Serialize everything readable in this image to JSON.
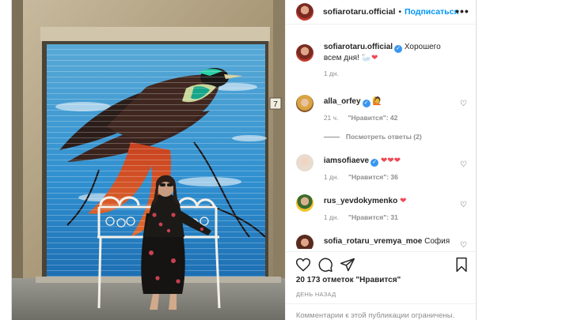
{
  "post": {
    "author": "sofiarotaru.official",
    "follow_label": "Подписаться",
    "more_label": "•••",
    "caption": {
      "user": "sofiarotaru.official",
      "text": "Хорошего всем дня!",
      "emoji": "🦢❤",
      "time": "1 дн."
    },
    "photo": {
      "door_number": "7"
    },
    "comments": [
      {
        "user": "alla_orfey",
        "verified": true,
        "text": "🙋",
        "time": "21 ч.",
        "likes": "\"Нравится\": 42",
        "replies": "Посмотреть ответы (2)"
      },
      {
        "user": "iamsofiaeve",
        "verified": true,
        "text": "❤❤❤",
        "time": "1 дн.",
        "likes": "\"Нравится\": 36"
      },
      {
        "user": "rus_yevdokymenko",
        "verified": false,
        "text": "❤",
        "time": "1 дн.",
        "likes": "\"Нравится\": 31"
      },
      {
        "user": "sofia_rotaru_vremya_moe",
        "verified": false,
        "text": "София"
      }
    ],
    "likes_count": "20 173 отметок \"Нравится\"",
    "posted_ago": "ДЕНЬ НАЗАД",
    "comments_closed": "Комментарии к этой публикации ограничены."
  },
  "icons": [
    "heart-outline-icon",
    "comment-icon",
    "share-icon",
    "bookmark-icon",
    "verified-badge-icon",
    "small-heart-icon",
    "more-options-icon"
  ],
  "colors": {
    "accent": "#0095f6",
    "verified": "#3897f0",
    "heart_red": "#ed4956",
    "muted": "#8e8e8e"
  }
}
